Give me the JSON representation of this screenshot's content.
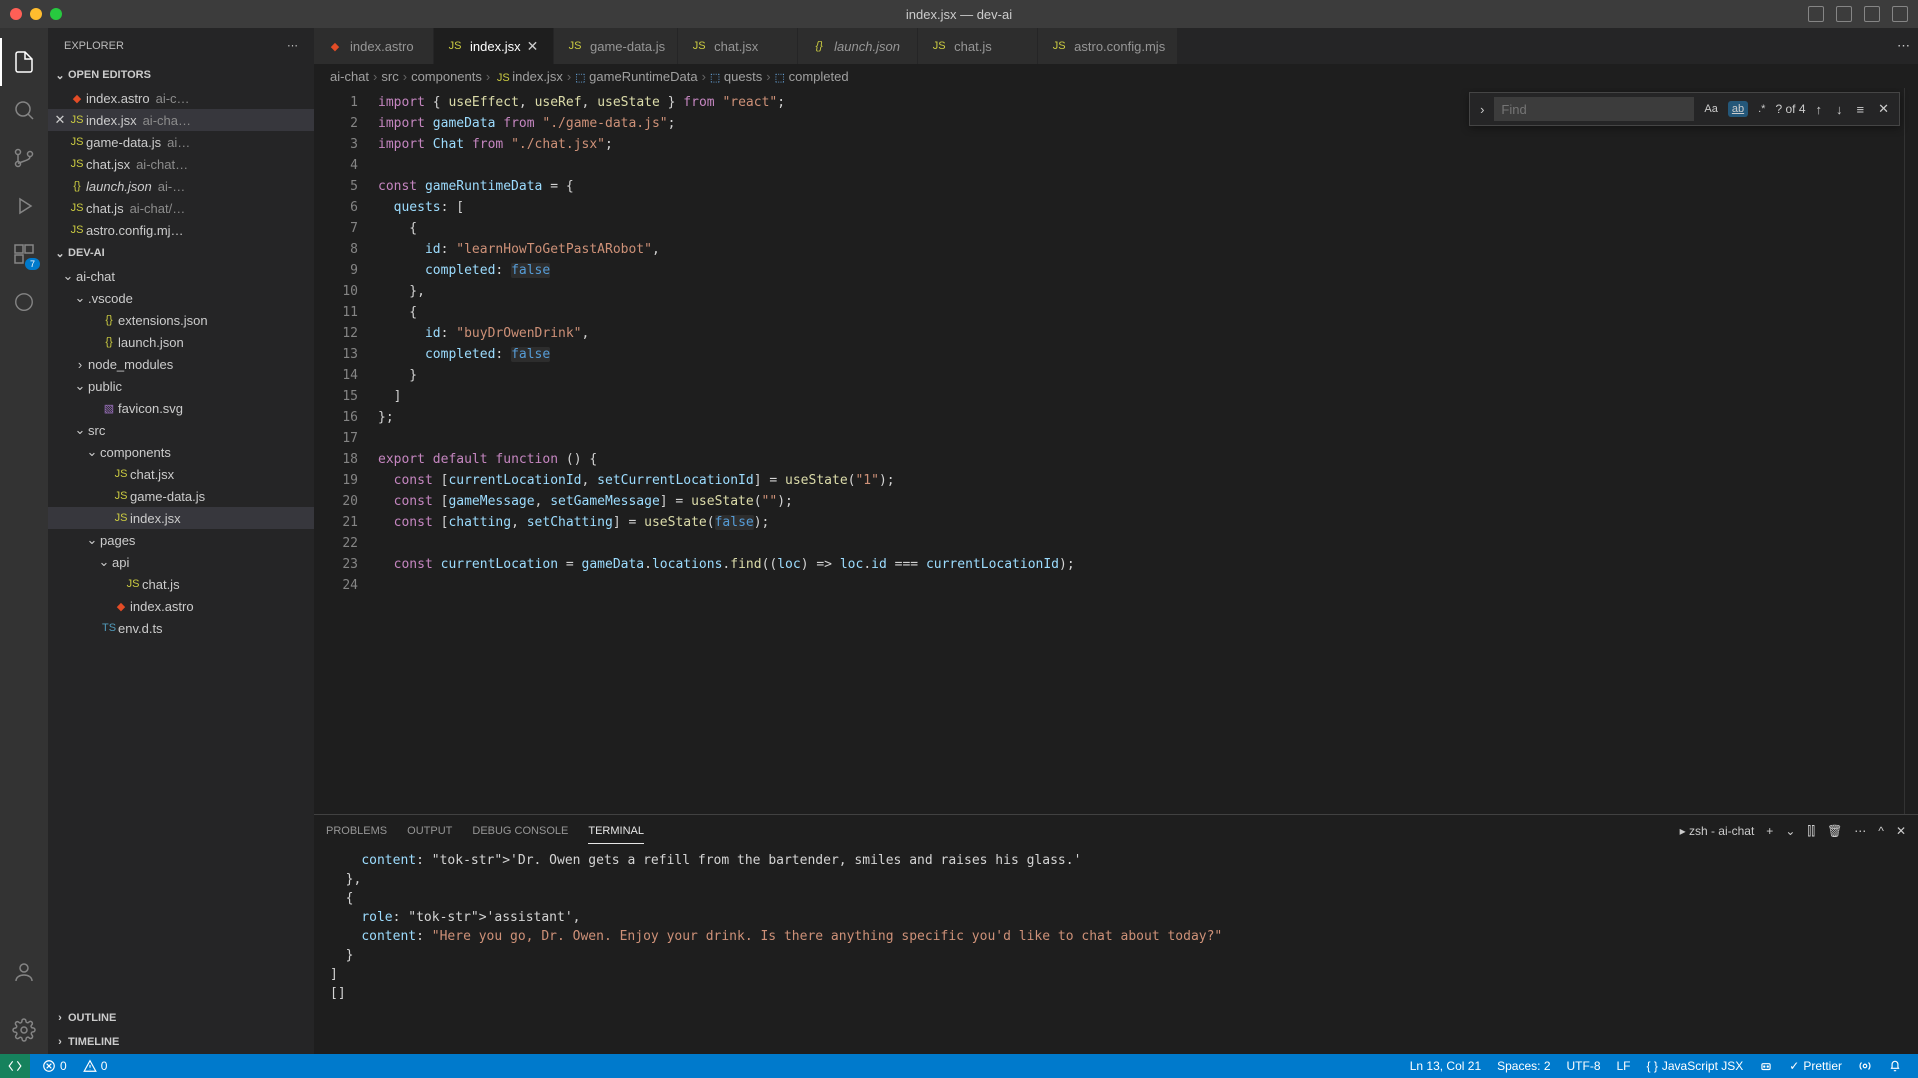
{
  "window": {
    "title": "index.jsx — dev-ai"
  },
  "explorer": {
    "title": "EXPLORER",
    "openEditors": {
      "label": "OPEN EDITORS",
      "items": [
        {
          "name": "index.astro",
          "desc": "ai-c…",
          "icon": "astro"
        },
        {
          "name": "index.jsx",
          "desc": "ai-cha…",
          "icon": "js",
          "active": true,
          "close": true
        },
        {
          "name": "game-data.js",
          "desc": "ai…",
          "icon": "js"
        },
        {
          "name": "chat.jsx",
          "desc": "ai-chat…",
          "icon": "js"
        },
        {
          "name": "launch.json",
          "desc": "ai-…",
          "icon": "json",
          "italic": true
        },
        {
          "name": "chat.js",
          "desc": "ai-chat/…",
          "icon": "js"
        },
        {
          "name": "astro.config.mj…",
          "desc": "",
          "icon": "js"
        }
      ]
    },
    "project": {
      "label": "DEV-AI",
      "tree": [
        {
          "depth": 0,
          "chev": "down",
          "name": "ai-chat",
          "icon": ""
        },
        {
          "depth": 1,
          "chev": "down",
          "name": ".vscode",
          "icon": ""
        },
        {
          "depth": 2,
          "name": "extensions.json",
          "icon": "json"
        },
        {
          "depth": 2,
          "name": "launch.json",
          "icon": "json"
        },
        {
          "depth": 1,
          "chev": "right",
          "name": "node_modules",
          "icon": ""
        },
        {
          "depth": 1,
          "chev": "down",
          "name": "public",
          "icon": ""
        },
        {
          "depth": 2,
          "name": "favicon.svg",
          "icon": "svg"
        },
        {
          "depth": 1,
          "chev": "down",
          "name": "src",
          "icon": ""
        },
        {
          "depth": 2,
          "chev": "down",
          "name": "components",
          "icon": ""
        },
        {
          "depth": 3,
          "name": "chat.jsx",
          "icon": "js"
        },
        {
          "depth": 3,
          "name": "game-data.js",
          "icon": "js"
        },
        {
          "depth": 3,
          "name": "index.jsx",
          "icon": "js",
          "selected": true
        },
        {
          "depth": 2,
          "chev": "down",
          "name": "pages",
          "icon": ""
        },
        {
          "depth": 3,
          "chev": "down",
          "name": "api",
          "icon": ""
        },
        {
          "depth": 4,
          "name": "chat.js",
          "icon": "js"
        },
        {
          "depth": 3,
          "name": "index.astro",
          "icon": "astro"
        },
        {
          "depth": 2,
          "name": "env.d.ts",
          "icon": "ts"
        }
      ]
    },
    "outline": "OUTLINE",
    "timeline": "TIMELINE"
  },
  "tabs": [
    {
      "name": "index.astro",
      "icon": "astro"
    },
    {
      "name": "index.jsx",
      "icon": "js",
      "active": true,
      "close": true
    },
    {
      "name": "game-data.js",
      "icon": "js"
    },
    {
      "name": "chat.jsx",
      "icon": "js"
    },
    {
      "name": "launch.json",
      "icon": "json",
      "italic": true
    },
    {
      "name": "chat.js",
      "icon": "js"
    },
    {
      "name": "astro.config.mjs",
      "icon": "js"
    }
  ],
  "breadcrumbs": [
    "ai-chat",
    "src",
    "components",
    "index.jsx",
    "gameRuntimeData",
    "quests",
    "completed"
  ],
  "find": {
    "placeholder": "Find",
    "count": "? of 4"
  },
  "code": {
    "lines": [
      "import { useEffect, useRef, useState } from \"react\";",
      "import gameData from \"./game-data.js\";",
      "import Chat from \"./chat.jsx\";",
      "",
      "const gameRuntimeData = {",
      "  quests: [",
      "    {",
      "      id: \"learnHowToGetPastARobot\",",
      "      completed: false",
      "    },",
      "    {",
      "      id: \"buyDrOwenDrink\",",
      "      completed: false",
      "    }",
      "  ]",
      "};",
      "",
      "export default function () {",
      "  const [currentLocationId, setCurrentLocationId] = useState(\"1\");",
      "  const [gameMessage, setGameMessage] = useState(\"\");",
      "  const [chatting, setChatting] = useState(false);",
      "",
      "  const currentLocation = gameData.locations.find((loc) => loc.id === currentLocationId);",
      ""
    ],
    "startLine": 1
  },
  "panel": {
    "tabs": [
      "PROBLEMS",
      "OUTPUT",
      "DEBUG CONSOLE",
      "TERMINAL"
    ],
    "activeTab": 3,
    "shell": "zsh - ai-chat",
    "content": "    content: 'Dr. Owen gets a refill from the bartender, smiles and raises his glass.'\n  },\n  {\n    role: 'assistant',\n    content: \"Here you go, Dr. Owen. Enjoy your drink. Is there anything specific you'd like to chat about today?\"\n  }\n]\n[]"
  },
  "status": {
    "errors": "0",
    "warnings": "0",
    "cursor": "Ln 13, Col 21",
    "spaces": "Spaces: 2",
    "encoding": "UTF-8",
    "eol": "LF",
    "lang": "JavaScript JSX",
    "prettier": "Prettier"
  },
  "activity": {
    "scmBadge": "7"
  }
}
